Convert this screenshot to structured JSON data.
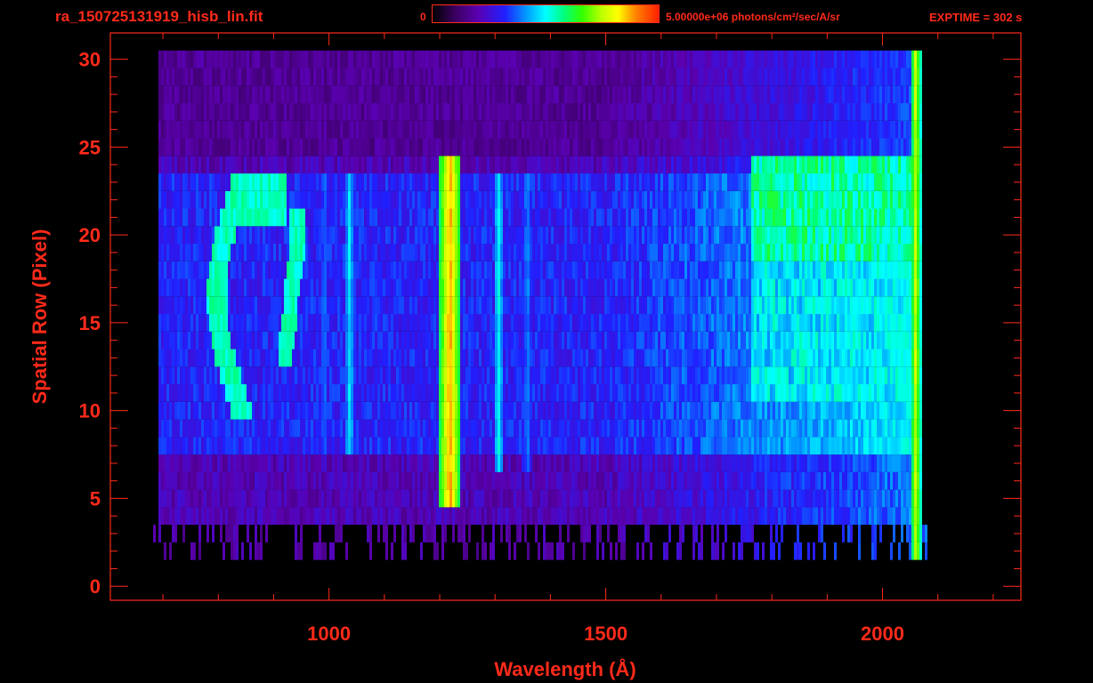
{
  "header": {
    "filename": "ra_150725131919_hisb_lin.fit",
    "colorbar_min": "0",
    "colorbar_max": "5.00000e+06 photons/cm²/sec/A/sr",
    "exptime": "EXPTIME = 302 s"
  },
  "colors": {
    "axis": "#ff2a1a",
    "background": "#000000"
  },
  "chart_data": {
    "type": "heatmap",
    "title": "ra_150725131919_hisb_lin.fit",
    "xlabel": "Wavelength (Å)",
    "ylabel": "Spatial Row (Pixel)",
    "xlim": [
      605,
      2250
    ],
    "ylim": [
      -0.8,
      31.5
    ],
    "x_ticks": [
      1000,
      1500,
      2000
    ],
    "y_ticks": [
      0,
      5,
      10,
      15,
      20,
      25,
      30
    ],
    "colorbar": {
      "min": 0,
      "max": 5000000,
      "units": "photons/cm²/sec/A/sr",
      "scale": "linear"
    },
    "grid": false,
    "features": [
      {
        "name": "bright emission line",
        "x": 1216,
        "y_range": [
          5,
          24
        ],
        "level": 0.85
      },
      {
        "name": "emission line",
        "x": 1304,
        "y_range": [
          7,
          23
        ],
        "level": 0.48
      },
      {
        "name": "emission line",
        "x": 1356,
        "y_range": [
          7,
          23
        ],
        "level": 0.38
      },
      {
        "name": "emission line",
        "x": 1035,
        "y_range": [
          8,
          23
        ],
        "level": 0.45
      },
      {
        "name": "emission line",
        "x": 989,
        "y_range": [
          8,
          23
        ],
        "level": 0.35
      },
      {
        "name": "arc feature",
        "x_range": [
          800,
          940
        ],
        "y_range": [
          10,
          23
        ],
        "level": 0.5
      },
      {
        "name": "long-wavelength continuum",
        "x_range": [
          1760,
          2060
        ],
        "y_range": [
          11,
          24
        ],
        "level": 0.6
      },
      {
        "name": "detector edge",
        "x": 2058,
        "y_range": [
          1.5,
          30
        ],
        "level": 0.75
      }
    ]
  }
}
